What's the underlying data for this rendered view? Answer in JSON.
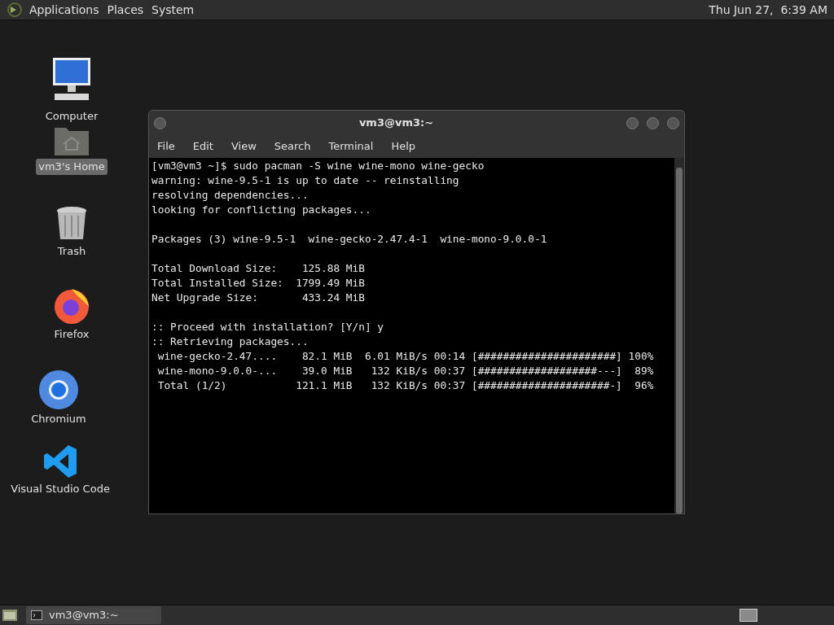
{
  "top_panel": {
    "menus": [
      "Applications",
      "Places",
      "System"
    ],
    "clock": "Thu Jun 27,  6:39 AM"
  },
  "desktop_icons": [
    {
      "kind": "computer",
      "label": "Computer",
      "selected": false
    },
    {
      "kind": "home",
      "label": "vm3's Home",
      "selected": true
    },
    {
      "kind": "trash",
      "label": "Trash",
      "selected": false
    },
    {
      "kind": "firefox",
      "label": "Firefox",
      "selected": false
    },
    {
      "kind": "chromium",
      "label": "Chromium",
      "selected": false
    },
    {
      "kind": "vscode",
      "label": "Visual Studio Code",
      "selected": false
    }
  ],
  "terminal": {
    "title": "vm3@vm3:~",
    "menu": [
      "File",
      "Edit",
      "View",
      "Search",
      "Terminal",
      "Help"
    ],
    "blocks": [
      [
        "[vm3@vm3 ~]$ sudo pacman -S wine wine-mono wine-gecko",
        "warning: wine-9.5-1 is up to date -- reinstalling",
        "resolving dependencies...",
        "looking for conflicting packages..."
      ],
      [
        "Packages (3) wine-9.5-1  wine-gecko-2.47.4-1  wine-mono-9.0.0-1"
      ],
      [
        "Total Download Size:    125.88 MiB",
        "Total Installed Size:  1799.49 MiB",
        "Net Upgrade Size:       433.24 MiB"
      ],
      [
        ":: Proceed with installation? [Y/n] y",
        ":: Retrieving packages...",
        " wine-gecko-2.47....    82.1 MiB  6.01 MiB/s 00:14 [######################] 100%",
        " wine-mono-9.0.0-...    39.0 MiB   132 KiB/s 00:37 [###################---]  89%",
        " Total (1/2)           121.1 MiB   132 KiB/s 00:37 [#####################-]  96%"
      ]
    ]
  },
  "taskbar": {
    "tasks": [
      {
        "label": "vm3@vm3:~",
        "selected": false
      }
    ]
  }
}
